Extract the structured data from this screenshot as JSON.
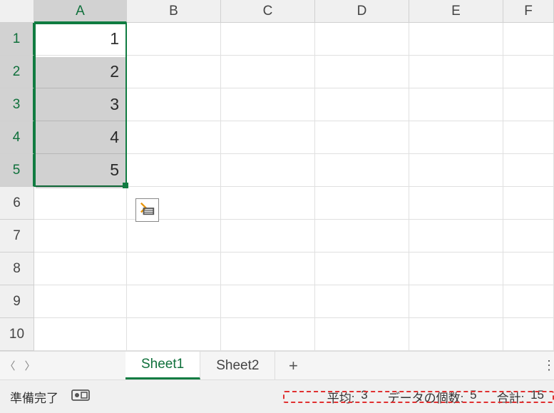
{
  "columns": [
    "A",
    "B",
    "C",
    "D",
    "E",
    "F"
  ],
  "col_widths": {
    "A": 130,
    "B": 132,
    "C": 132,
    "D": 132,
    "E": 132,
    "F": 71
  },
  "rows": [
    1,
    2,
    3,
    4,
    5,
    6,
    7,
    8,
    9,
    10
  ],
  "cells": {
    "A1": 1,
    "A2": 2,
    "A3": 3,
    "A4": 4,
    "A5": 5
  },
  "selection": {
    "col": "A",
    "row_start": 1,
    "row_end": 5
  },
  "tabs": {
    "items": [
      {
        "label": "Sheet1",
        "active": true
      },
      {
        "label": "Sheet2",
        "active": false
      }
    ],
    "add_label": "+",
    "overflow": "⋮"
  },
  "statusbar": {
    "ready_label": "準備完了",
    "stats": {
      "avg_label": "平均:",
      "avg_value": "3",
      "count_label": "データの個数:",
      "count_value": "5",
      "sum_label": "合計:",
      "sum_value": "15"
    }
  }
}
